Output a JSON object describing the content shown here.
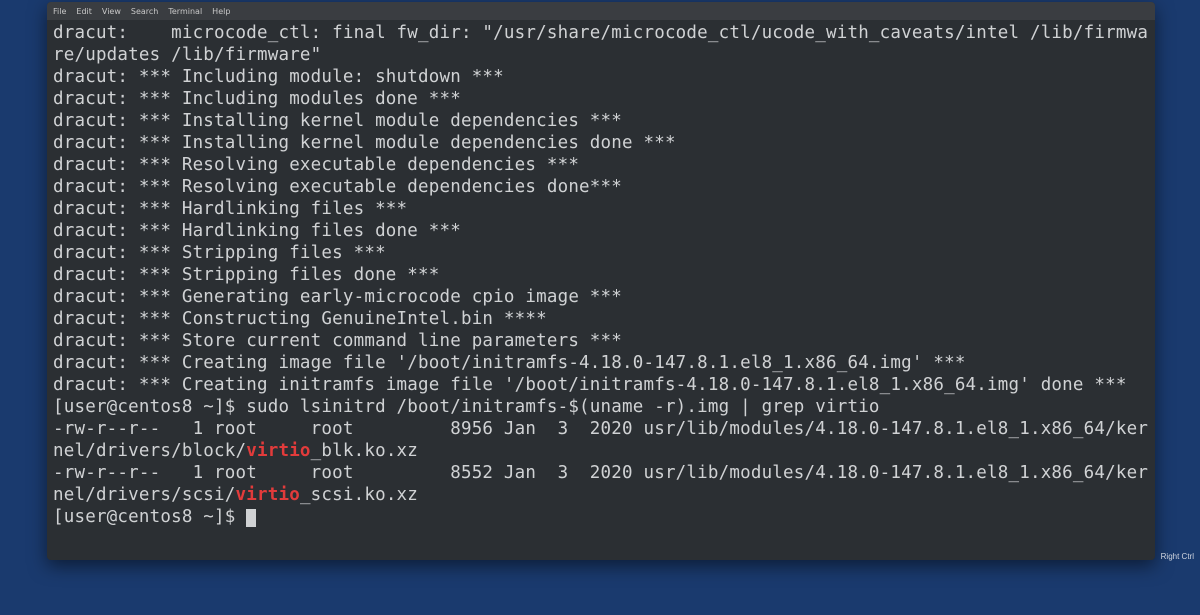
{
  "menu": {
    "file": "File",
    "edit": "Edit",
    "view": "View",
    "search": "Search",
    "terminal": "Terminal",
    "help": "Help"
  },
  "lines": [
    {
      "t": "dracut:    microcode_ctl: final fw_dir: \"/usr/share/microcode_ctl/ucode_with_caveats/intel /lib/firmware/updates /lib/firmware\""
    },
    {
      "t": "dracut: *** Including module: shutdown ***"
    },
    {
      "t": "dracut: *** Including modules done ***"
    },
    {
      "t": "dracut: *** Installing kernel module dependencies ***"
    },
    {
      "t": "dracut: *** Installing kernel module dependencies done ***"
    },
    {
      "t": "dracut: *** Resolving executable dependencies ***"
    },
    {
      "t": "dracut: *** Resolving executable dependencies done***"
    },
    {
      "t": "dracut: *** Hardlinking files ***"
    },
    {
      "t": "dracut: *** Hardlinking files done ***"
    },
    {
      "t": "dracut: *** Stripping files ***"
    },
    {
      "t": "dracut: *** Stripping files done ***"
    },
    {
      "t": "dracut: *** Generating early-microcode cpio image ***"
    },
    {
      "t": "dracut: *** Constructing GenuineIntel.bin ****"
    },
    {
      "t": "dracut: *** Store current command line parameters ***"
    },
    {
      "t": "dracut: *** Creating image file '/boot/initramfs-4.18.0-147.8.1.el8_1.x86_64.img' ***"
    },
    {
      "t": "dracut: *** Creating initramfs image file '/boot/initramfs-4.18.0-147.8.1.el8_1.x86_64.img' done ***"
    },
    {
      "t": "[user@centos8 ~]$ sudo lsinitrd /boot/initramfs-$(uname -r).img | grep virtio"
    },
    {
      "seg": [
        {
          "t": "-rw-r--r--   1 root     root         8956 Jan  3  2020 usr/lib/modules/4.18.0-147.8.1.el8_1.x86_64/kernel/drivers/block/"
        },
        {
          "t": "virtio",
          "c": "hl"
        },
        {
          "t": "_blk.ko.xz"
        }
      ]
    },
    {
      "seg": [
        {
          "t": "-rw-r--r--   1 root     root         8552 Jan  3  2020 usr/lib/modules/4.18.0-147.8.1.el8_1.x86_64/kernel/drivers/scsi/"
        },
        {
          "t": "virtio",
          "c": "hl"
        },
        {
          "t": "_scsi.ko.xz"
        }
      ]
    },
    {
      "prompt": "[user@centos8 ~]$ ",
      "cursor": true
    }
  ],
  "tray": "Right Ctrl"
}
